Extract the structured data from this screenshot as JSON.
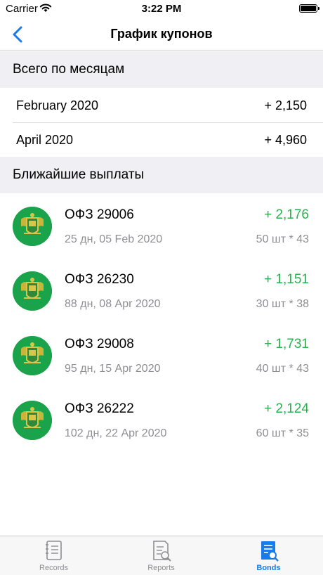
{
  "status": {
    "carrier": "Carrier",
    "time": "3:22 PM"
  },
  "nav": {
    "title": "График купонов"
  },
  "monthly": {
    "header": "Всего по месяцам",
    "rows": [
      {
        "name": "February 2020",
        "amount": "+ 2,150"
      },
      {
        "name": "April 2020",
        "amount": "+ 4,960"
      }
    ]
  },
  "upcoming": {
    "header": "Ближайшие выплаты",
    "rows": [
      {
        "name": "ОФЗ 29006",
        "date": "25 дн, 05 Feb 2020",
        "amount": "+ 2,176",
        "qty": "50 шт * 43"
      },
      {
        "name": "ОФЗ 26230",
        "date": "88 дн, 08 Apr 2020",
        "amount": "+ 1,151",
        "qty": "30 шт * 38"
      },
      {
        "name": "ОФЗ 29008",
        "date": "95 дн, 15 Apr 2020",
        "amount": "+ 1,731",
        "qty": "40 шт * 43"
      },
      {
        "name": "ОФЗ 26222",
        "date": "102 дн, 22 Apr 2020",
        "amount": "+ 2,124",
        "qty": "60 шт * 35"
      }
    ]
  },
  "tabs": [
    {
      "label": "Records",
      "icon": "records-icon",
      "active": false
    },
    {
      "label": "Reports",
      "icon": "reports-icon",
      "active": false
    },
    {
      "label": "Bonds",
      "icon": "bonds-icon",
      "active": true
    }
  ],
  "colors": {
    "accent": "#1a7be8",
    "positive": "#28b24c",
    "emblem_bg": "#1aa34a",
    "section_bg": "#efeff4"
  }
}
